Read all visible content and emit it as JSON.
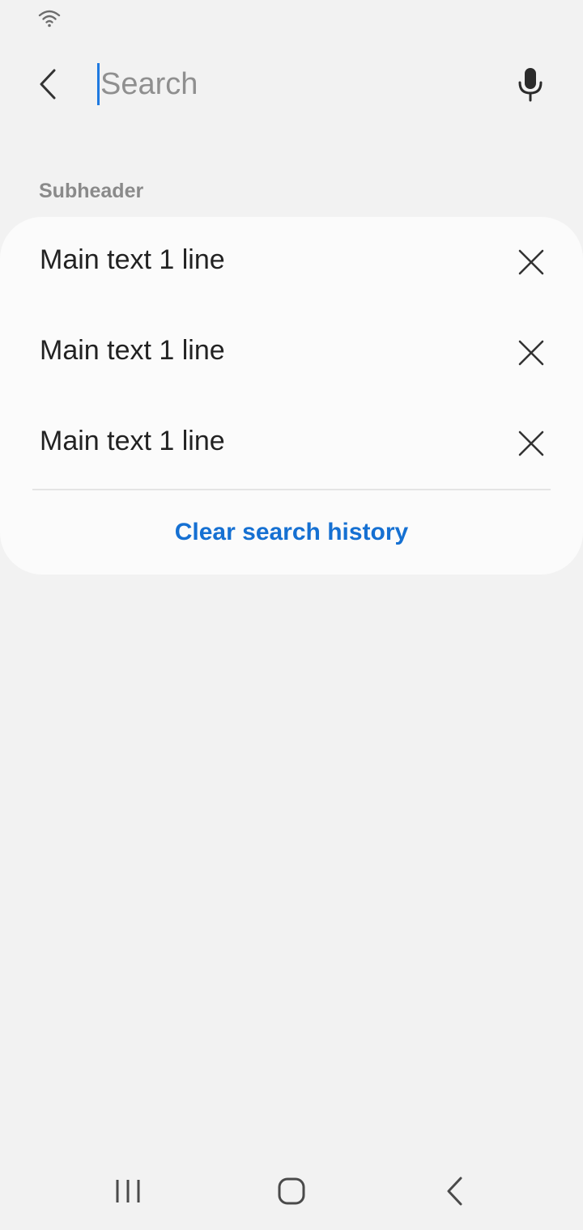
{
  "status_bar": {
    "wifi_icon": "wifi-icon"
  },
  "search": {
    "placeholder": "Search",
    "value": "",
    "back_icon": "chevron-left-icon",
    "mic_icon": "microphone-icon",
    "caret_color": "#1f7ae0"
  },
  "history": {
    "subheader": "Subheader",
    "items": [
      {
        "label": "Main text 1 line",
        "remove_icon": "close-icon"
      },
      {
        "label": "Main text 1 line",
        "remove_icon": "close-icon"
      },
      {
        "label": "Main text 1 line",
        "remove_icon": "close-icon"
      }
    ],
    "clear_label": "Clear search history",
    "accent_color": "#1570d2"
  },
  "nav_bar": {
    "recents_icon": "recents-icon",
    "home_icon": "home-icon",
    "back_icon": "back-icon"
  }
}
